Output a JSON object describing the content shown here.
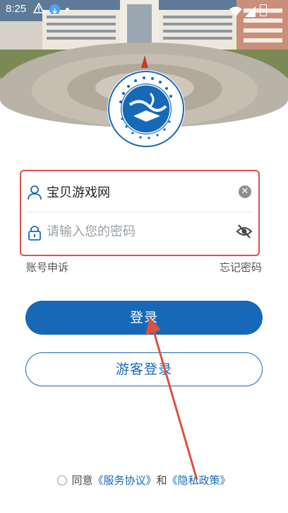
{
  "status_bar": {
    "time": "8:25"
  },
  "logo": {
    "ring_text": "曲靖医学高等专科学校",
    "english": "QU JING MEDICAL COLLEGE"
  },
  "login": {
    "username_value": "宝贝游戏网",
    "password_placeholder": "请输入您的密码",
    "account_appeal": "账号申诉",
    "forgot_password": "忘记密码",
    "login_button": "登录",
    "guest_button": "游客登录"
  },
  "agreement": {
    "prefix": "同意",
    "service": "《服务协议》",
    "and": "和",
    "privacy": "《隐私政策》"
  },
  "colors": {
    "primary": "#1769b8",
    "highlight_border": "#d9534b",
    "arrow": "#d9533f"
  },
  "icons": [
    "person-icon",
    "lock-icon",
    "clear-icon",
    "eye-off-icon",
    "warning-icon",
    "download-icon",
    "wifi-icon",
    "signal-icon",
    "battery-icon"
  ]
}
